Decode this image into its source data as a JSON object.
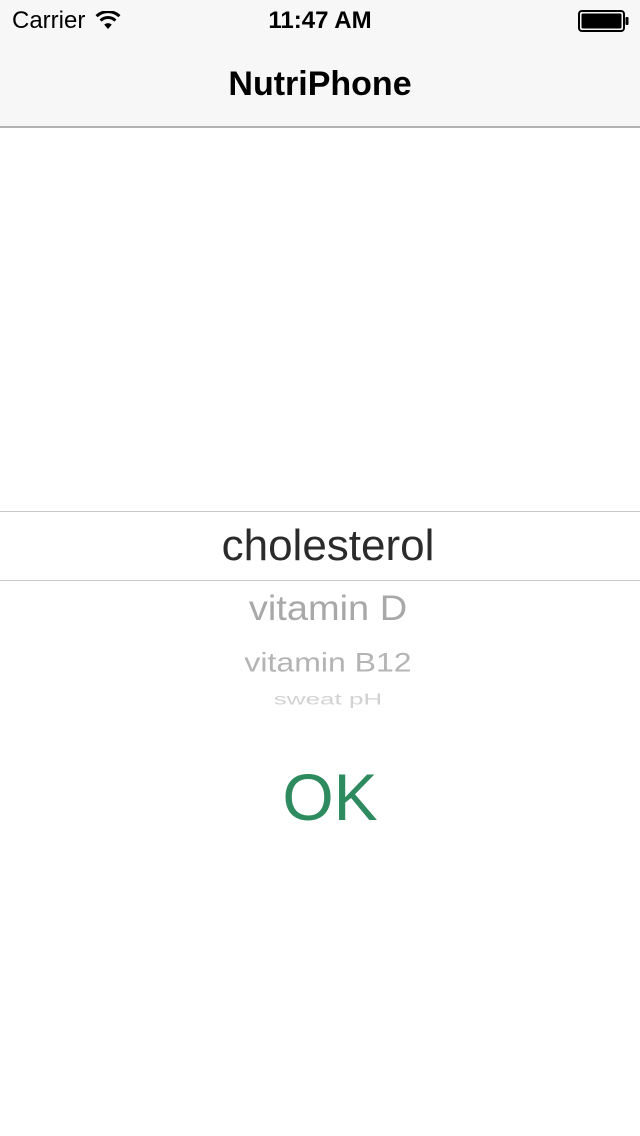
{
  "status_bar": {
    "carrier": "Carrier",
    "time": "11:47 AM",
    "wifi_icon": "wifi-icon",
    "battery_icon": "battery-icon"
  },
  "nav_bar": {
    "title": "NutriPhone"
  },
  "picker": {
    "selected": "cholesterol",
    "rows_below": [
      "vitamin D",
      "vitamin B12",
      "sweat pH"
    ]
  },
  "ok_button": {
    "label": "OK",
    "color": "#2e8b5f"
  },
  "colors": {
    "nav_background": "#f7f7f7",
    "separator": "#b2b2b2",
    "selected_text": "#2b2b2b",
    "faded_text": "#a8a8a8"
  }
}
